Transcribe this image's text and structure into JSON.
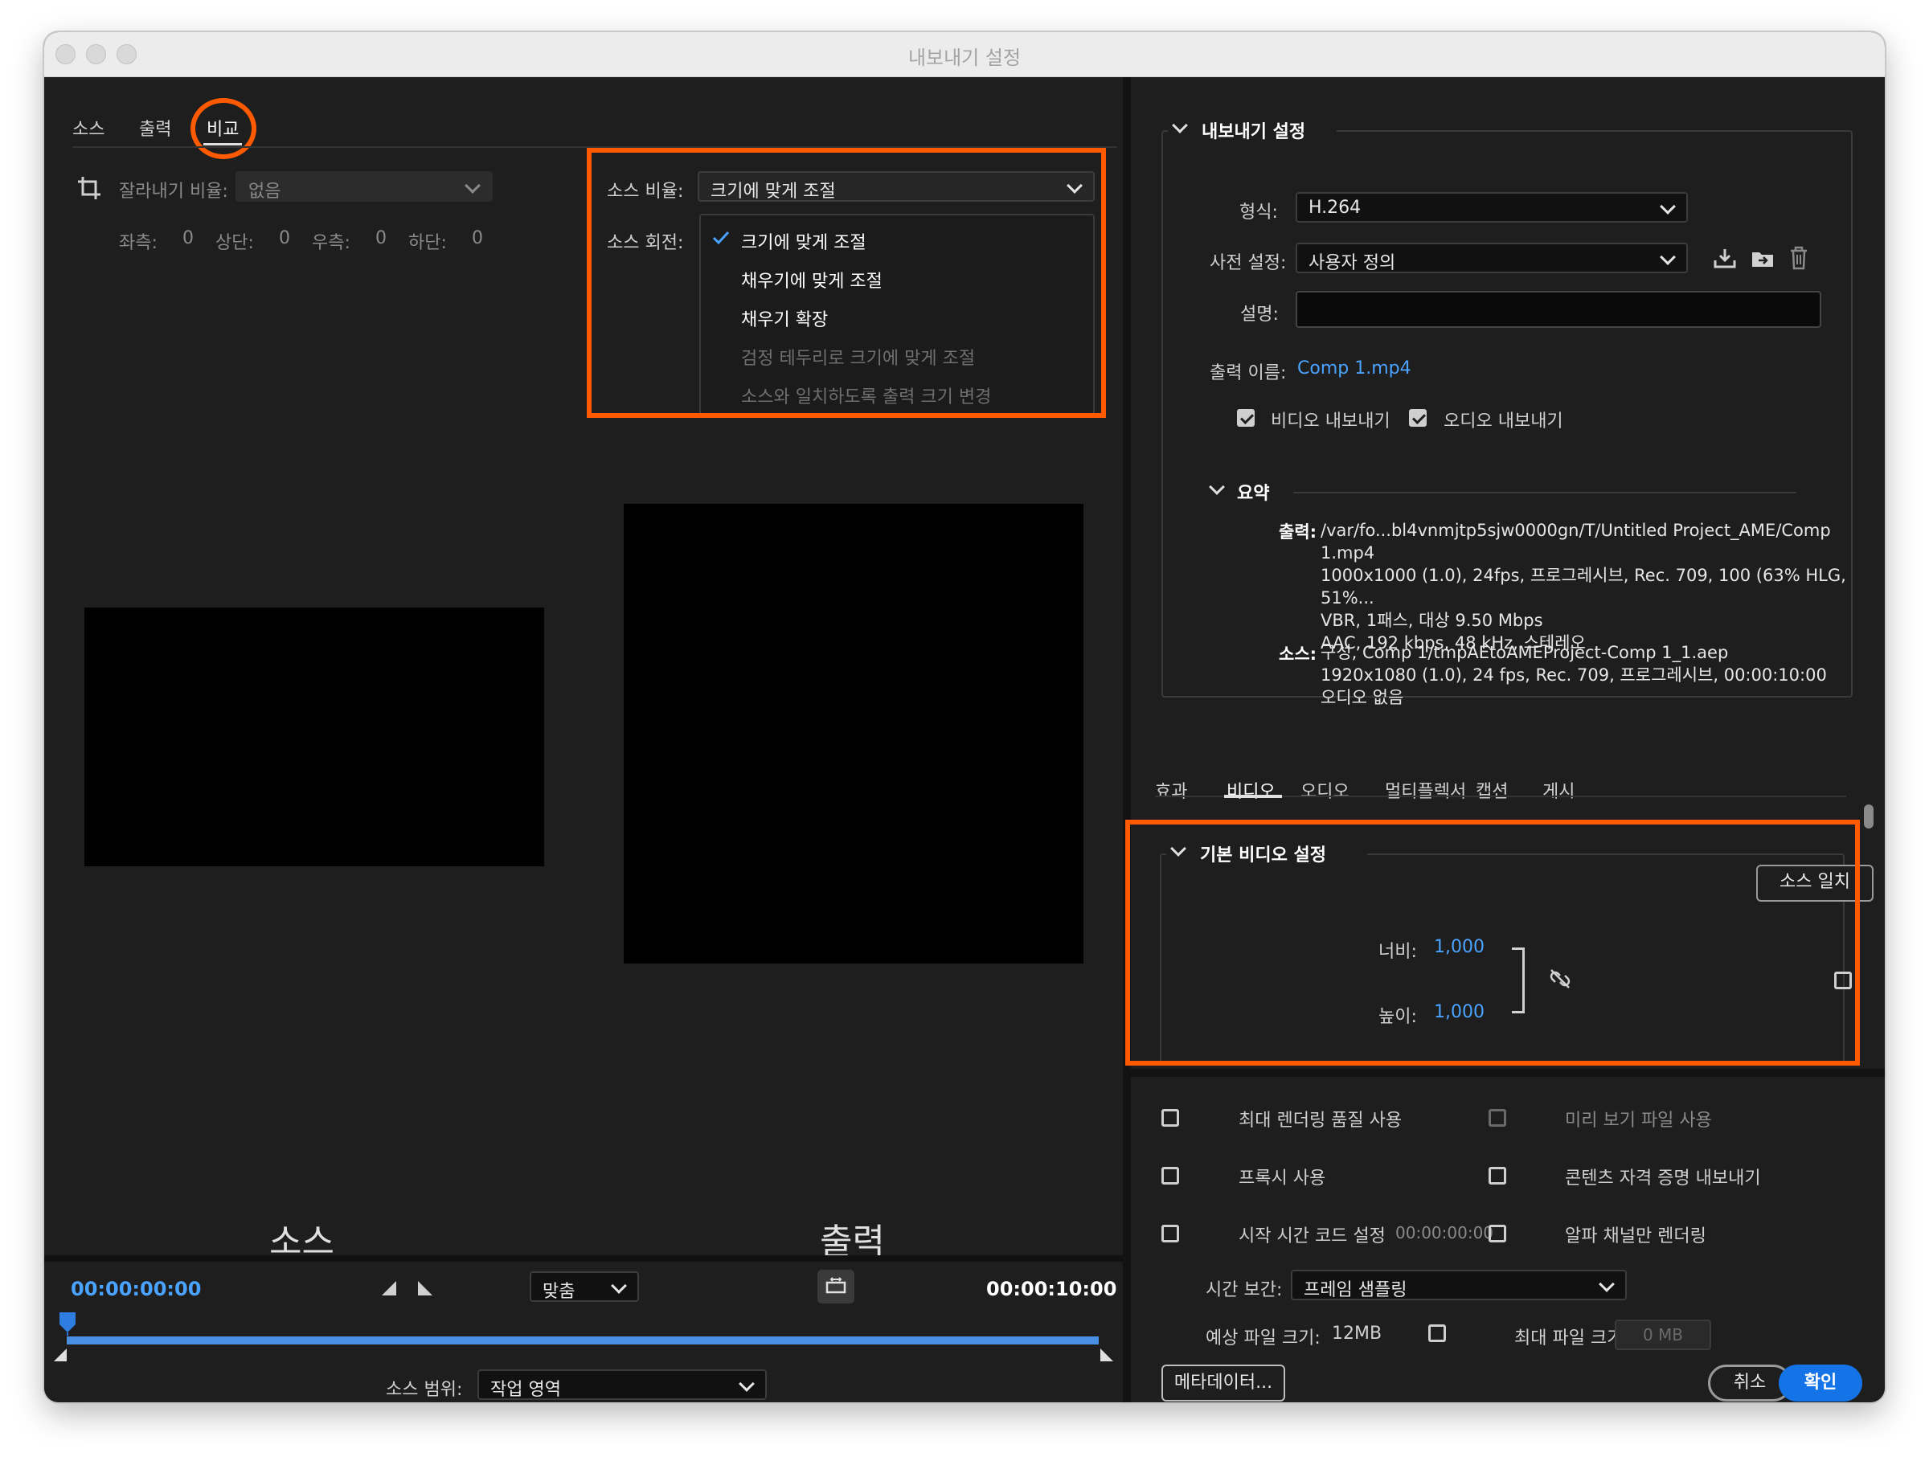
{
  "window": {
    "title": "내보내기 설정"
  },
  "left": {
    "tabs": [
      "소스",
      "출력",
      "비교"
    ],
    "crop": {
      "label": "잘라내기 비율:",
      "value": "없음",
      "left_label": "좌측:",
      "left": "0",
      "top_label": "상단:",
      "top": "0",
      "right_label": "우측:",
      "right": "0",
      "bottom_label": "하단:",
      "bottom": "0"
    },
    "source_scaling": {
      "label": "소스 비율:",
      "value": "크기에 맞게 조절"
    },
    "source_rotation": {
      "label": "소스 회전:"
    },
    "dropdown_options": [
      "크기에 맞게 조절",
      "채우기에 맞게 조절",
      "채우기 확장",
      "검정 테두리로 크기에 맞게 조절",
      "소스와 일치하도록 출력 크기 변경"
    ],
    "preview_source_label": "소스",
    "preview_output_label": "출력",
    "timeline": {
      "start": "00:00:00:00",
      "end": "00:00:10:00",
      "fit": "맞춤",
      "range_label": "소스 범위:",
      "range_value": "작업 영역"
    }
  },
  "right": {
    "export_section_title": "내보내기 설정",
    "format_label": "형식:",
    "format": "H.264",
    "preset_label": "사전 설정:",
    "preset": "사용자 정의",
    "comment_label": "설명:",
    "comment": "",
    "output_name_label": "출력 이름:",
    "output_name": "Comp 1.mp4",
    "export_video": "비디오 내보내기",
    "export_audio": "오디오 내보내기",
    "summary_title": "요약",
    "summary_output_label": "출력:",
    "summary_output_lines": [
      "/var/fo...bl4vnmjtp5sjw0000gn/T/Untitled Project_AME/Comp 1.mp4",
      "1000x1000 (1.0), 24fps, 프로그레시브, Rec. 709, 100 (63% HLG, 51%...",
      "VBR, 1패스, 대상 9.50 Mbps",
      "AAC, 192 kbps, 48 kHz, 스테레오"
    ],
    "summary_source_label": "소스:",
    "summary_source_lines": [
      "구성, Comp 1/tmpAEtoAMEProject-Comp 1_1.aep",
      "1920x1080 (1.0), 24 fps, Rec. 709, 프로그레시브, 00:00:10:00",
      "오디오 없음"
    ],
    "tabs": [
      "효과",
      "비디오",
      "오디오",
      "멀티플렉서",
      "캡션",
      "게시"
    ],
    "active_tab": "비디오",
    "basic_video_title": "기본 비디오 설정",
    "match_source": "소스 일치",
    "width_label": "너비:",
    "width": "1,000",
    "height_label": "높이:",
    "height": "1,000",
    "options": {
      "max_render": "최대 렌더링 품질 사용",
      "use_previews": "미리 보기 파일 사용",
      "use_proxies": "프록시 사용",
      "export_credentials": "콘텐츠 자격 증명 내보내기",
      "start_timecode": "시작 시간 코드 설정",
      "start_timecode_value": "00:00:00:00",
      "alpha_only": "알파 채널만 렌더링"
    },
    "time_interp_label": "시간 보간:",
    "time_interp": "프레임 샘플링",
    "est_size_label": "예상 파일 크기:",
    "est_size": "12MB",
    "max_size_label": "최대 파일 크기:",
    "max_size": "0 MB",
    "metadata_button": "메타데이터...",
    "cancel_button": "취소",
    "ok_button": "확인"
  },
  "colors": {
    "accent": "#1473e6",
    "highlight": "#ff5a00",
    "link": "#4aa3ff"
  }
}
